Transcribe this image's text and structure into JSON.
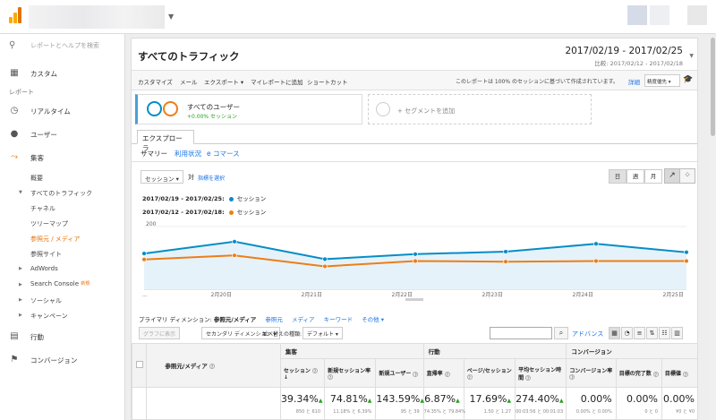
{
  "sidebar": {
    "search_placeholder": "レポートとヘルプを検索",
    "custom": "カスタム",
    "reports_section": "レポート",
    "realtime": "リアルタイム",
    "audience": "ユーザー",
    "acquisition": "集客",
    "acq_items": {
      "overview": "概要",
      "all_traffic": "すべてのトラフィック",
      "channels": "チャネル",
      "treemaps": "ツリーマップ",
      "source_medium": "参照元 / メディア",
      "referrals": "参照サイト",
      "adwords": "AdWords",
      "search_console": "Search Console",
      "new_badge": "新規",
      "social": "ソーシャル",
      "campaigns": "キャンペーン"
    },
    "behavior": "行動",
    "conversions": "コンバージョン"
  },
  "header": {
    "title": "すべてのトラフィック",
    "date_range": "2017/02/19 - 2017/02/25",
    "compare_range": "比較: 2017/02/12 - 2017/02/18"
  },
  "toolbar": {
    "customize": "カスタマイズ",
    "email": "メール",
    "export": "エクスポート ▾",
    "add_to_dashboard": "マイレポートに追加",
    "shortcut": "ショートカット",
    "note": "このレポートは 100% のセッションに基づいて作成されています。",
    "details": "詳細",
    "precision": "精度優先 ▾"
  },
  "segments": {
    "all_users": "すべてのユーザー",
    "all_users_pct": "+0.00% セッション",
    "add_segment": "+ セグメントを追加"
  },
  "explorer": {
    "tab": "エクスプローラ",
    "subtabs": [
      "サマリー",
      "利用状況",
      "e コマース"
    ]
  },
  "chart_controls": {
    "metric": "セッション ▾",
    "vs": "対",
    "select_metric": "指標を選択",
    "granularity": [
      "日",
      "週",
      "月"
    ]
  },
  "legend": {
    "current_range": "2017/02/19 - 2017/02/25:",
    "previous_range": "2017/02/12 - 2017/02/18:",
    "series_name": "セッション"
  },
  "chart_data": {
    "type": "line",
    "x": [
      "2/19",
      "2/20",
      "2/21",
      "2/22",
      "2/23",
      "2/24",
      "2/25"
    ],
    "x_tick_labels": [
      "...",
      "2月20日",
      "2月21日",
      "2月22日",
      "2月23日",
      "2月24日",
      "2月25日"
    ],
    "y_tick_labels": [
      "200",
      "100"
    ],
    "ylim": [
      0,
      200
    ],
    "series": [
      {
        "name": "2017/02/19 - 2017/02/25",
        "color": "#058dc7",
        "values": [
          114,
          152,
          96,
          112,
          120,
          145,
          118
        ],
        "filled": true
      },
      {
        "name": "2017/02/12 - 2017/02/18",
        "color": "#ed7e17",
        "values": [
          95,
          108,
          73,
          90,
          88,
          90,
          90
        ],
        "filled": false
      }
    ],
    "legend": "top-left",
    "grid": true
  },
  "dimensions": {
    "primary_label": "プライマリ ディメンション:",
    "selected": "参照元/メディア",
    "options": [
      "参照元",
      "メディア",
      "キーワード",
      "その他 ▾"
    ]
  },
  "table_controls": {
    "plot_rows": "グラフに表示",
    "secondary_dim": "セカンダリ ディメンション ▾",
    "sort_type_label": "並べ替えの種類:",
    "sort_default": "デフォルト ▾",
    "advanced": "アドバンス"
  },
  "table": {
    "dim_header": "参照元/メディア",
    "groups": [
      "集客",
      "行動",
      "コンバージョン"
    ],
    "columns": [
      {
        "label": "セッション",
        "total": "39.34%",
        "sub": "850 と 610"
      },
      {
        "label": "新規セッション率",
        "total": "74.81%",
        "sub": "11.18% と 6.39%"
      },
      {
        "label": "新規ユーザー",
        "total": "143.59%",
        "sub": "95 と 39"
      },
      {
        "label": "直帰率",
        "total": "6.87%",
        "sub": "74.35% と 79.84%"
      },
      {
        "label": "ページ/セッション",
        "total": "17.69%",
        "sub": "1.50 と 1.27"
      },
      {
        "label": "平均セッション時間",
        "total": "274.40%",
        "sub": "00:03:56 と 00:01:03"
      },
      {
        "label": "コンバージョン率",
        "total": "0.00%",
        "sub": "0.00% と 0.00%"
      },
      {
        "label": "目標の完了数",
        "total": "0.00%",
        "sub": "0 と 0"
      },
      {
        "label": "目標値",
        "total": "0.00%",
        "sub": "¥0 と ¥0"
      }
    ]
  }
}
